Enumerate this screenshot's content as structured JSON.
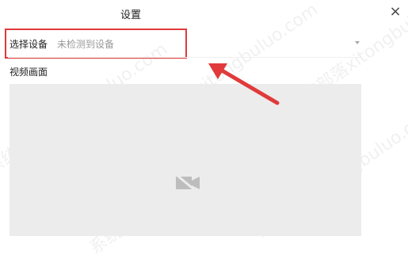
{
  "window": {
    "title": "设置",
    "close_glyph": "×"
  },
  "device": {
    "label": "选择设备",
    "value": "未检测到设备"
  },
  "video": {
    "label": "视频画面",
    "icon": "camera-off-icon"
  },
  "watermark": {
    "text": "系统部落xitongbuluo.com"
  },
  "colors": {
    "highlight": "#e03a3a",
    "video_bg": "#ececec"
  }
}
